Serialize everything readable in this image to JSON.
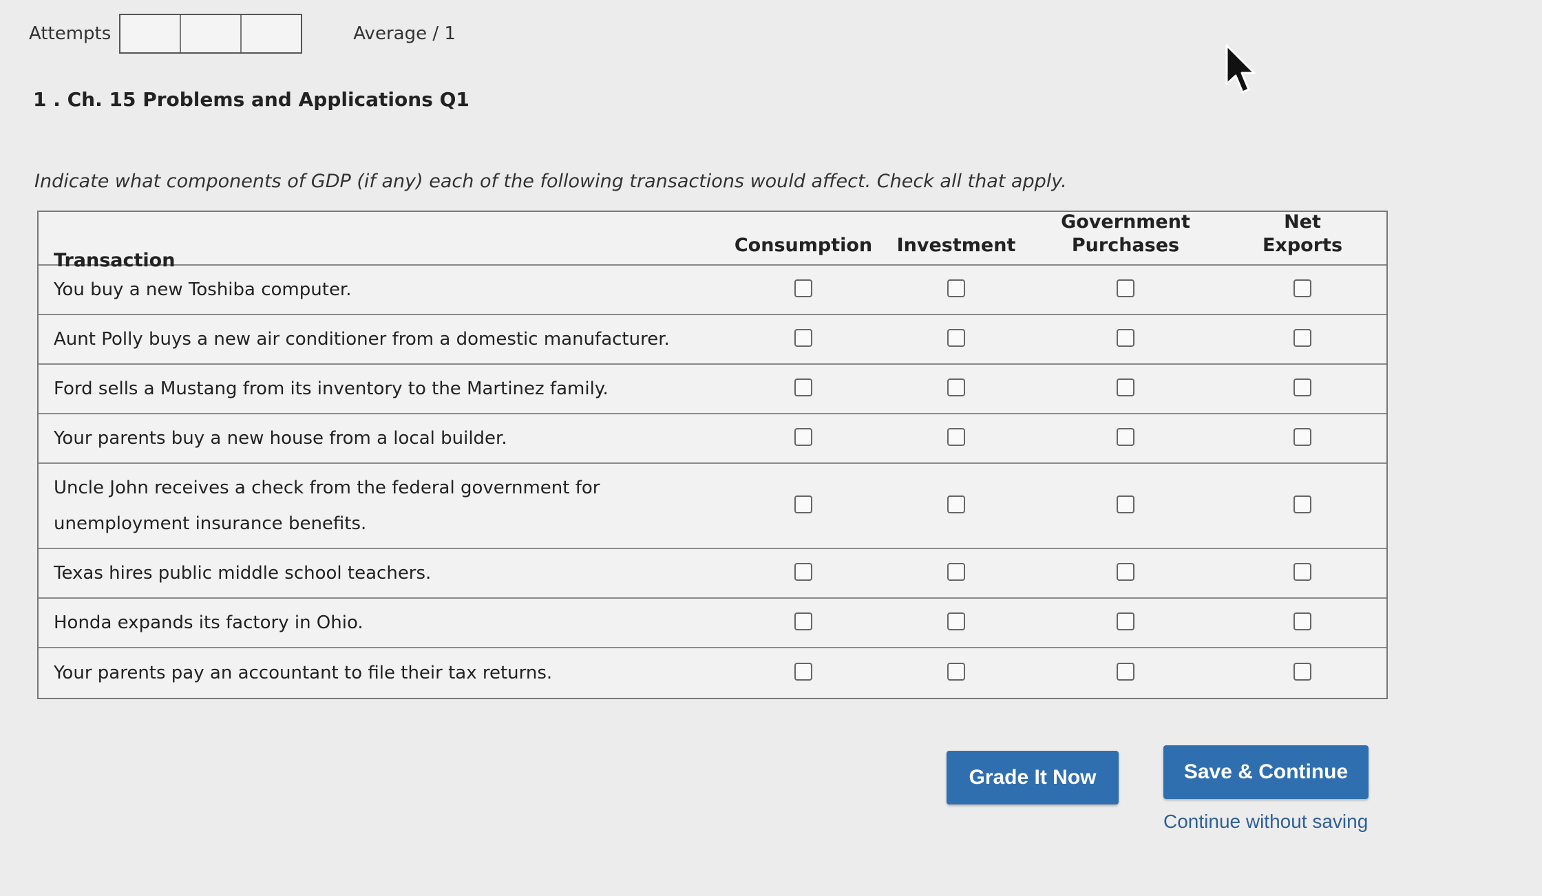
{
  "attempts": {
    "label": "Attempts",
    "average_label": "Average / 1"
  },
  "question": {
    "title": "1 . Ch. 15 Problems and Applications Q1",
    "instructions": "Indicate what components of GDP (if any) each of the following transactions would affect. Check all that apply."
  },
  "table": {
    "headers": {
      "transaction": "Transaction",
      "consumption": "Consumption",
      "investment": "Investment",
      "government_line1": "Government",
      "government_line2": "Purchases",
      "net_line1": "Net",
      "net_line2": "Exports"
    },
    "rows": [
      {
        "transaction": "You buy a new Toshiba computer."
      },
      {
        "transaction": "Aunt Polly buys a new air conditioner from a domestic manufacturer."
      },
      {
        "transaction": "Ford sells a Mustang from its inventory to the Martinez family."
      },
      {
        "transaction": "Your parents buy a new house from a local builder."
      },
      {
        "transaction": "Uncle John receives a check from the federal government for",
        "transaction_line2": "unemployment insurance benefits."
      },
      {
        "transaction": "Texas hires public middle school teachers."
      },
      {
        "transaction": "Honda expands its factory in Ohio."
      },
      {
        "transaction": "Your parents pay an accountant to file their tax returns."
      }
    ]
  },
  "buttons": {
    "grade": "Grade It Now",
    "save": "Save & Continue",
    "continue_without_saving": "Continue without saving"
  },
  "colors": {
    "button_blue": "#2f6fb0",
    "link_blue": "#2f5f95"
  }
}
